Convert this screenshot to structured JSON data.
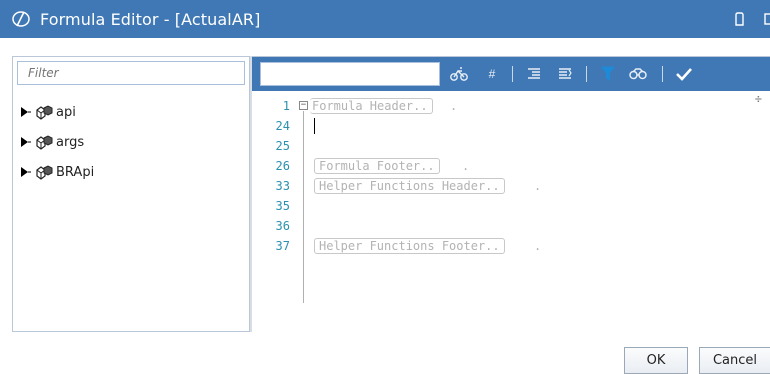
{
  "window": {
    "title": "Formula Editor - [ActualAR]",
    "title_bar_color": "#3f78b4",
    "icons": [
      "logo-icon",
      "restore-icon",
      "maximize-icon"
    ]
  },
  "left_panel": {
    "filter_placeholder": "Filter",
    "tree": [
      {
        "label": "api",
        "icon": "namespace-icon"
      },
      {
        "label": "args",
        "icon": "namespace-icon"
      },
      {
        "label": "BRApi",
        "icon": "namespace-icon"
      }
    ]
  },
  "toolbar": {
    "search_value": "",
    "buttons": [
      "bicycle-icon",
      "hash-icon",
      "indent-icon",
      "outdent-icon",
      "filter-icon",
      "binoculars-icon",
      "check-icon"
    ],
    "filter_icon_color": "#1e8ad8"
  },
  "editor": {
    "lines": [
      {
        "number": "1",
        "region": "Formula Header..",
        "suffix": "."
      },
      {
        "number": "24",
        "region": "",
        "suffix": ""
      },
      {
        "number": "25",
        "region": "",
        "suffix": ""
      },
      {
        "number": "26",
        "region": "Formula Footer..",
        "suffix": "."
      },
      {
        "number": "33",
        "region": "Helper Functions Header..",
        "suffix": "."
      },
      {
        "number": "35",
        "region": "",
        "suffix": ""
      },
      {
        "number": "36",
        "region": "",
        "suffix": ""
      },
      {
        "number": "37",
        "region": "Helper Functions Footer..",
        "suffix": "."
      }
    ],
    "line_number_color": "#2b91af",
    "split_glyph": "÷"
  },
  "dialog_buttons": {
    "ok": "OK",
    "cancel": "Cancel"
  }
}
